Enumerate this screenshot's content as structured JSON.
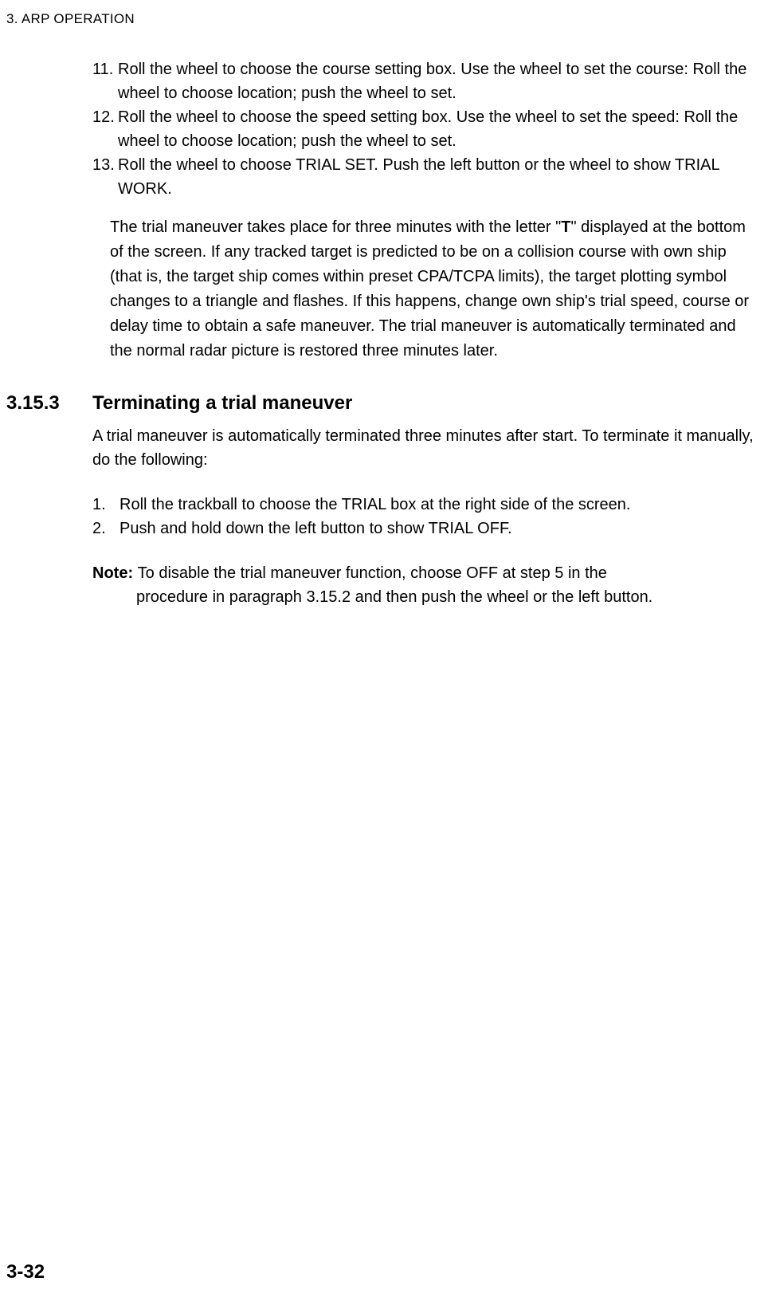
{
  "header": "3. ARP OPERATION",
  "list": {
    "item11_num": "11.",
    "item11": "Roll the wheel to choose the course setting box. Use the wheel to set the course: Roll the wheel to choose location; push the wheel to set.",
    "item12_num": "12.",
    "item12": "Roll the wheel to choose the speed setting box. Use the wheel to set the speed: Roll the wheel to choose location; push the wheel to set.",
    "item13_num": "13.",
    "item13": "Roll the wheel to choose TRIAL SET. Push the left button or the wheel to show TRIAL WORK."
  },
  "explanation": {
    "pre": "The trial maneuver takes place for three minutes with the letter \"",
    "bold": "T",
    "post": "\" displayed at the bottom of the screen. If any tracked target is predicted to be on a collision course with own ship (that is, the target ship comes within preset CPA/TCPA limits), the target plotting symbol changes to a triangle and flashes. If this happens, change own ship's trial speed, course or delay time to obtain a safe maneuver. The trial maneuver is automatically terminated and the normal radar picture is restored three minutes later."
  },
  "section": {
    "number": "3.15.3",
    "title": "Terminating a trial maneuver",
    "body": "A trial maneuver is automatically terminated three minutes after start. To terminate it manually, do the following:"
  },
  "steps": {
    "step1_num": "1.",
    "step1": "Roll the trackball to choose the TRIAL box at the right side of the screen.",
    "step2_num": "2.",
    "step2": "Push and hold down the left button to show TRIAL OFF."
  },
  "note": {
    "label": "Note: ",
    "line1": "To disable the trial maneuver function, choose OFF at step 5 in the",
    "line2": "procedure in paragraph 3.15.2 and then push the wheel or the left button."
  },
  "pageNumber": "3-32"
}
